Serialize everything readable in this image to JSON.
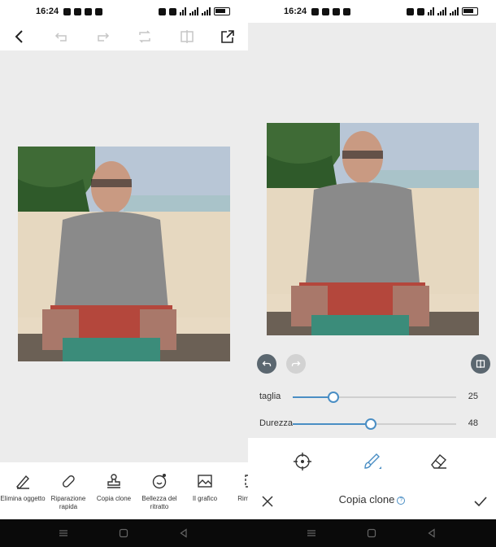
{
  "left": {
    "status": {
      "time": "16:24"
    },
    "tools": [
      {
        "icon": "eraser-pen-icon",
        "label": "Elimina oggetto"
      },
      {
        "icon": "bandage-icon",
        "label": "Riparazione rapida"
      },
      {
        "icon": "stamp-icon",
        "label": "Copia clone"
      },
      {
        "icon": "face-beauty-icon",
        "label": "Bellezza del ritratto"
      },
      {
        "icon": "image-icon",
        "label": "Il grafico"
      },
      {
        "icon": "crop-icon",
        "label": "Rim sfon"
      }
    ]
  },
  "right": {
    "status": {
      "time": "16:24"
    },
    "sliders": [
      {
        "label": "taglia",
        "value": "25",
        "fraction": 0.25
      },
      {
        "label": "Durezza",
        "value": "48",
        "fraction": 0.48
      }
    ],
    "title": "Copia clone",
    "help_glyph": "?"
  },
  "colors": {
    "accent": "#4a8ec4",
    "background": "#ececec"
  }
}
